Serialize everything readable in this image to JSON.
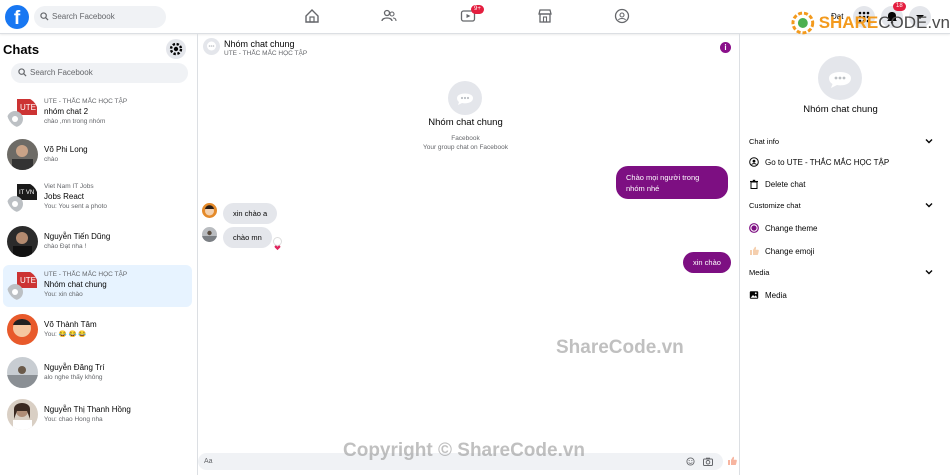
{
  "topbar": {
    "logo": "f",
    "search_placeholder": "Search Facebook",
    "video_badge": "9+",
    "notif_badge": "18",
    "user_name": "Đạt",
    "nav_icons": [
      "home-icon",
      "friends-icon",
      "watch-icon",
      "marketplace-icon",
      "groups-icon"
    ]
  },
  "sidebar": {
    "title": "Chats",
    "search_placeholder": "Search Facebook",
    "chats": [
      {
        "group": "UTE - THẮC MẮC HỌC TẬP",
        "name": "nhóm chat 2",
        "preview": "chào ,mn trong nhóm"
      },
      {
        "group": "",
        "name": "Võ Phi Long",
        "preview": "chào"
      },
      {
        "group": "Viet Nam IT Jobs",
        "name": "Jobs React",
        "preview": "You: You sent a photo"
      },
      {
        "group": "",
        "name": "Nguyễn Tiến Dũng",
        "preview": "chào Đạt nha !"
      },
      {
        "group": "UTE - THẮC MẮC HỌC TẬP",
        "name": "Nhóm chat chung",
        "preview": "You: xin chào"
      },
      {
        "group": "",
        "name": "Võ Thành Tâm",
        "preview": "You: 😂 😂 😂"
      },
      {
        "group": "",
        "name": "Nguyễn Đăng Trí",
        "preview": "alo nghe thấy không"
      },
      {
        "group": "",
        "name": "Nguyễn Thị Thanh Hồng",
        "preview": "You: chao Hong nha"
      }
    ]
  },
  "conversation": {
    "name": "Nhóm chat chung",
    "subtitle": "UTE - THẮC MẮC HỌC TẬP",
    "intro_name": "Nhóm chat chung",
    "intro_source": "Facebook",
    "intro_desc": "Your group chat on Facebook",
    "messages": [
      {
        "text": "Chào mọi người trong nhóm nhé",
        "dir": "out"
      },
      {
        "text": "xin chào a",
        "dir": "in"
      },
      {
        "text": "chào mn",
        "dir": "in"
      },
      {
        "text": "xin chào",
        "dir": "out"
      }
    ],
    "composer_placeholder": "Aa"
  },
  "details": {
    "name": "Nhóm chat chung",
    "chat_info_label": "Chat info",
    "goto_label": "Go to UTE - THẮC MẮC HỌC TẬP",
    "delete_label": "Delete chat",
    "customize_label": "Customize chat",
    "theme_label": "Change theme",
    "emoji_label": "Change emoji",
    "media_section_label": "Media",
    "media_label": "Media"
  },
  "watermarks": {
    "center": "ShareCode.vn",
    "bottom": "Copyright © ShareCode.vn",
    "brand_main": "SHARE",
    "brand_sub": "CODE.vn"
  },
  "colors": {
    "accent": "#7d0f82",
    "fb_blue": "#1877f2",
    "active_bg": "#e7f3ff"
  }
}
